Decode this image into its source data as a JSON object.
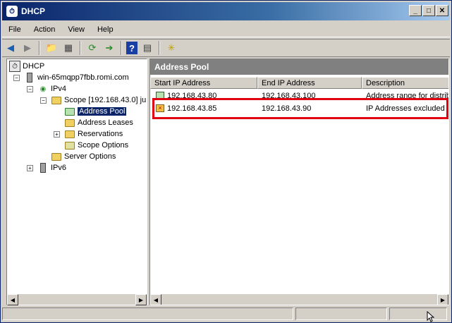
{
  "window": {
    "title": "DHCP",
    "app_icon": "dhcp-icon"
  },
  "menu": [
    "File",
    "Action",
    "View",
    "Help"
  ],
  "toolbar": {
    "icons": [
      "back-arrow-icon",
      "forward-arrow-icon",
      "up-folder-icon",
      "show-hide-tree-icon",
      "refresh-icon",
      "export-list-icon",
      "help-icon",
      "properties-icon",
      "star-icon"
    ]
  },
  "tree": {
    "root": "DHCP",
    "server": "win-65mqpp7fbb.romi.com",
    "ipv4": "IPv4",
    "scope": "Scope [192.168.43.0] ju",
    "address_pool": "Address Pool",
    "address_leases": "Address Leases",
    "reservations": "Reservations",
    "scope_options": "Scope Options",
    "server_options": "Server Options",
    "ipv6": "IPv6"
  },
  "pane": {
    "title": "Address Pool",
    "columns": [
      "Start IP Address",
      "End IP Address",
      "Description"
    ],
    "rows": [
      {
        "start": "192.168.43.80",
        "end": "192.168.43.100",
        "description": "Address range for distrib",
        "icon": "address-range-icon"
      },
      {
        "start": "192.168.43.85",
        "end": "192.168.43.90",
        "description": "IP Addresses excluded f",
        "icon": "exclusion-range-icon"
      }
    ]
  },
  "colors": {
    "titlebar": "#0a246a",
    "highlight_box": "#e00010",
    "selection": "#0a246a"
  }
}
